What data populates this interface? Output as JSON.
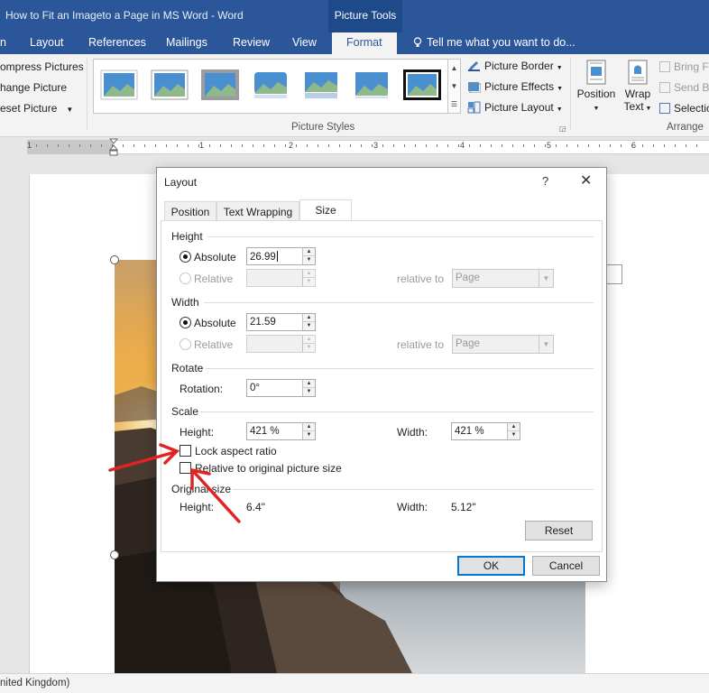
{
  "window": {
    "title": "How to Fit an Imageto a Page in MS Word - Word",
    "context_tab": "Picture Tools"
  },
  "ribbon_tabs": {
    "partial_first": "n",
    "layout": "Layout",
    "references": "References",
    "mailings": "Mailings",
    "review": "Review",
    "view": "View",
    "format": "Format",
    "tell_me": "Tell me what you want to do..."
  },
  "ribbon": {
    "adjust": {
      "compress": "ompress Pictures",
      "change": "hange Picture",
      "reset": "eset Picture"
    },
    "picture_border": "Picture Border",
    "picture_effects": "Picture Effects",
    "picture_layout": "Picture Layout",
    "picture_styles_label": "Picture Styles",
    "position": "Position",
    "wrap_text_1": "Wrap",
    "wrap_text_2": "Text",
    "bring_forward": "Bring F",
    "send_backward": "Send B",
    "selection_pane": "Selectio",
    "arrange_label": "Arrange"
  },
  "ruler": {
    "numbers": [
      "1",
      "1",
      "2",
      "3",
      "4",
      "5",
      "6"
    ]
  },
  "statusbar": {
    "language": "nited Kingdom)"
  },
  "dialog": {
    "title": "Layout",
    "help": "?",
    "close": "✕",
    "tabs": {
      "position": "Position",
      "text_wrapping": "Text Wrapping",
      "size": "Size"
    },
    "height": {
      "section": "Height",
      "absolute_label": "Absolute",
      "absolute_value": "26.99",
      "relative_label": "Relative",
      "relative_value": "",
      "relative_to_label": "relative to",
      "relative_to_value": "Page"
    },
    "width": {
      "section": "Width",
      "absolute_label": "Absolute",
      "absolute_value": "21.59",
      "relative_label": "Relative",
      "relative_value": "",
      "relative_to_label": "relative to",
      "relative_to_value": "Page"
    },
    "rotate": {
      "section": "Rotate",
      "rotation_label": "Rotation:",
      "rotation_value": "0°"
    },
    "scale": {
      "section": "Scale",
      "height_label": "Height:",
      "height_value": "421 %",
      "width_label": "Width:",
      "width_value": "421 %",
      "lock_aspect": "Lock aspect ratio",
      "lock_aspect_checked": false,
      "relative_original": "Relative to original picture size",
      "relative_original_checked": false
    },
    "original_size": {
      "section": "Original size",
      "height_label": "Height:",
      "height_value": "6.4\"",
      "width_label": "Width:",
      "width_value": "5.12\""
    },
    "reset_button": "Reset",
    "ok_button": "OK",
    "cancel_button": "Cancel"
  },
  "colors": {
    "word_blue": "#2b579a",
    "annotation_red": "#e02424"
  }
}
